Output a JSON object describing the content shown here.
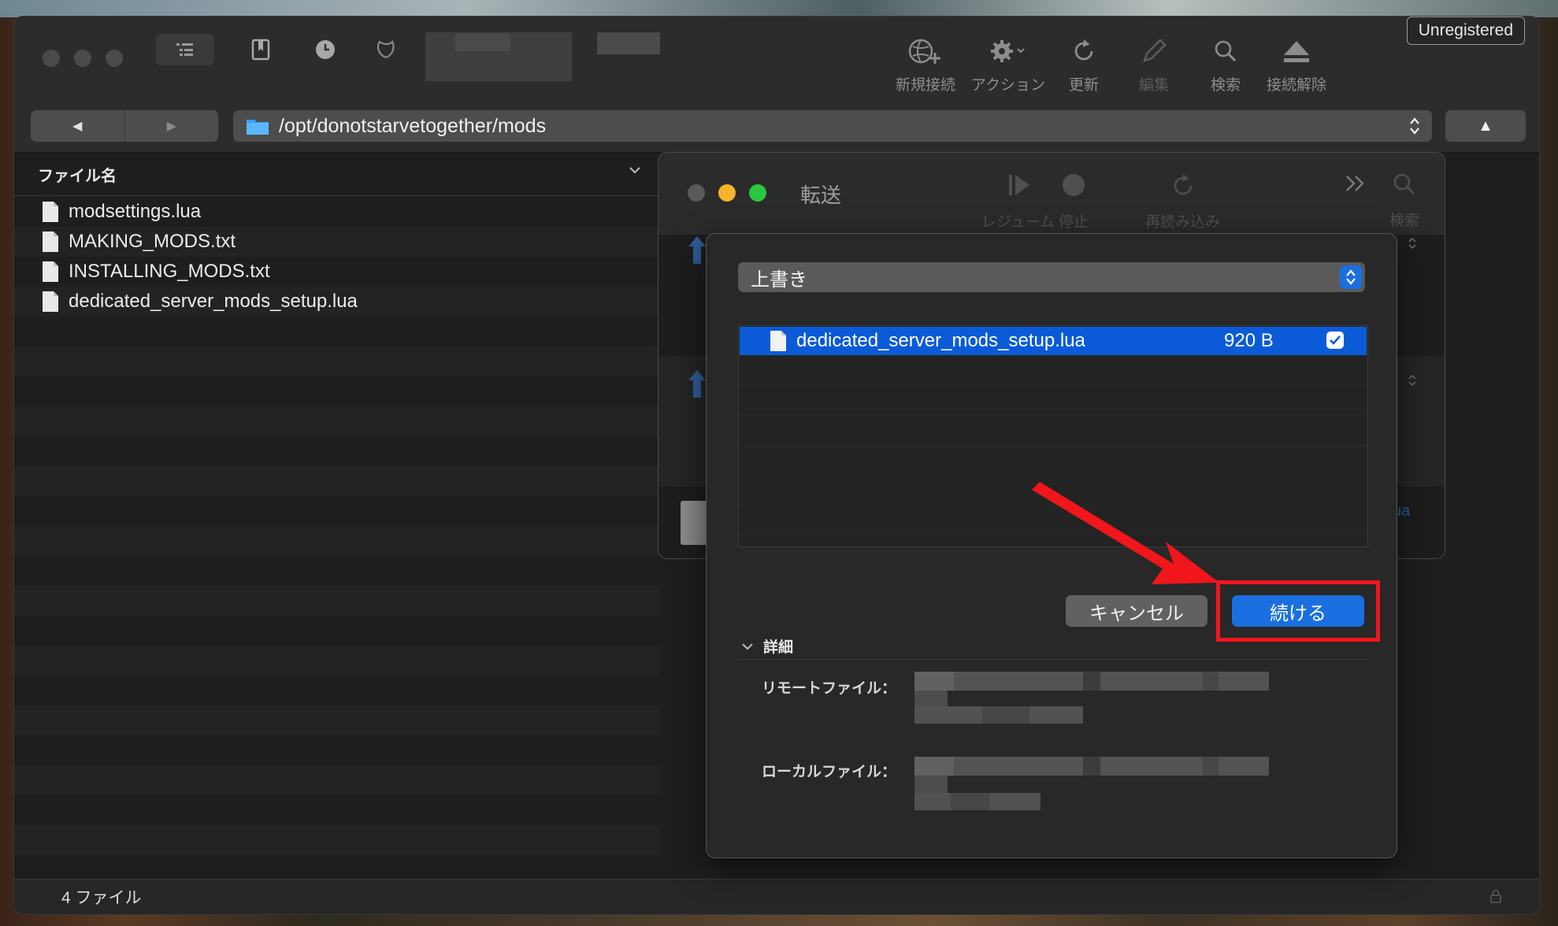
{
  "toolbar": {
    "actions": [
      {
        "icon": "new-connection-icon",
        "label": "新規接続"
      },
      {
        "icon": "gear-icon",
        "label": "アクション"
      },
      {
        "icon": "refresh-icon",
        "label": "更新"
      },
      {
        "icon": "pencil-icon",
        "label": "編集"
      },
      {
        "icon": "search-icon",
        "label": "検索"
      },
      {
        "icon": "eject-icon",
        "label": "接続解除"
      }
    ],
    "unregistered": "Unregistered"
  },
  "path": {
    "value": "/opt/donotstarvetogether/mods"
  },
  "file_list": {
    "header": "ファイル名",
    "files": [
      "modsettings.lua",
      "MAKING_MODS.txt",
      "INSTALLING_MODS.txt",
      "dedicated_server_mods_setup.lua"
    ],
    "status": "4 ファイル"
  },
  "transfer_window": {
    "title": "転送",
    "actions": [
      {
        "icon": "play-icon",
        "label": "レジューム"
      },
      {
        "icon": "stop-icon",
        "label": "停止"
      },
      {
        "icon": "reload-icon",
        "label": "再読み込み"
      },
      {
        "icon": "more-icon",
        "label": ""
      },
      {
        "icon": "search-icon",
        "label": "検索"
      }
    ],
    "partial_filename": "ua"
  },
  "overwrite_dialog": {
    "mode": "上書き",
    "row": {
      "filename": "dedicated_server_mods_setup.lua",
      "size": "920 B",
      "checked": true
    },
    "cancel_label": "キャンセル",
    "continue_label": "続ける",
    "details_label": "詳細",
    "remote_file_label": "リモートファイル：",
    "local_file_label": "ローカルファイル：",
    "accent_color": "#1a6fe0",
    "highlight_color": "#f0161c"
  }
}
